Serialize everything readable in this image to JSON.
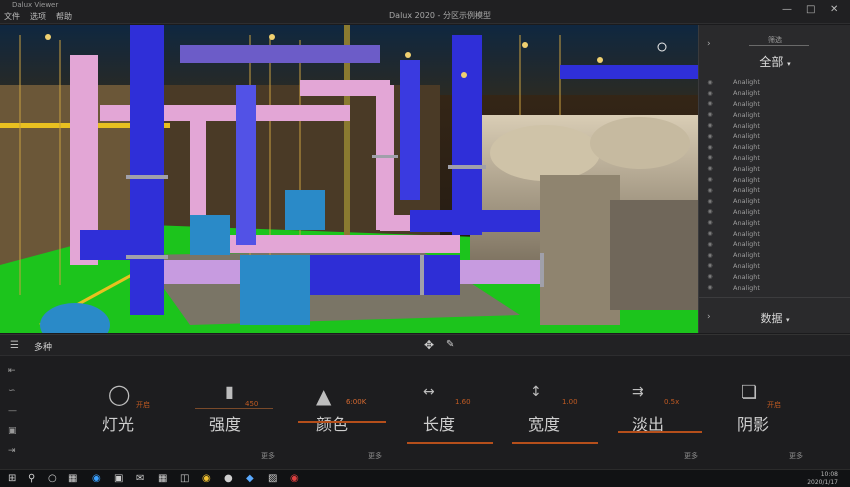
{
  "window": {
    "app_title": "Dalux Viewer",
    "menu": [
      "文件",
      "选项",
      "帮助"
    ],
    "doc_title": "Dalux 2020 - 分区示例模型",
    "controls": [
      "minimize-icon",
      "maximize-icon",
      "close-icon"
    ]
  },
  "right_panel": {
    "header": "筛选",
    "filter": "全部",
    "items": [
      "Analight",
      "Analight",
      "Analight",
      "Analight",
      "Analight",
      "Analight",
      "Analight",
      "Analight",
      "Analight",
      "Analight",
      "Analight",
      "Analight",
      "Analight",
      "Analight",
      "Analight",
      "Analight",
      "Analight",
      "Analight",
      "Analight",
      "Analight"
    ],
    "data_tab": "数据"
  },
  "toolbar": {
    "mode": "多种"
  },
  "controls": [
    {
      "label": "灯光",
      "value": "开启",
      "icon": "bulb-icon"
    },
    {
      "label": "强度",
      "value": "450",
      "icon": "intensity-icon"
    },
    {
      "label": "颜色",
      "value": "6:00K",
      "icon": "paint-bucket-icon"
    },
    {
      "label": "长度",
      "value": "1.60",
      "icon": "length-icon"
    },
    {
      "label": "宽度",
      "value": "1.00",
      "icon": "width-icon"
    },
    {
      "label": "淡出",
      "value": "0.5x",
      "icon": "fade-icon"
    },
    {
      "label": "阴影",
      "value": "开启",
      "icon": "shadow-cube-icon"
    }
  ],
  "more_label": "更多",
  "taskbar": {
    "time": "10:08",
    "date": "2020/1/17"
  },
  "colors": {
    "accent": "#b54f1b",
    "pipe_blue": "#2f2fd8",
    "pipe_pink": "#e3a6d6",
    "floor_green": "#1cc41c"
  }
}
